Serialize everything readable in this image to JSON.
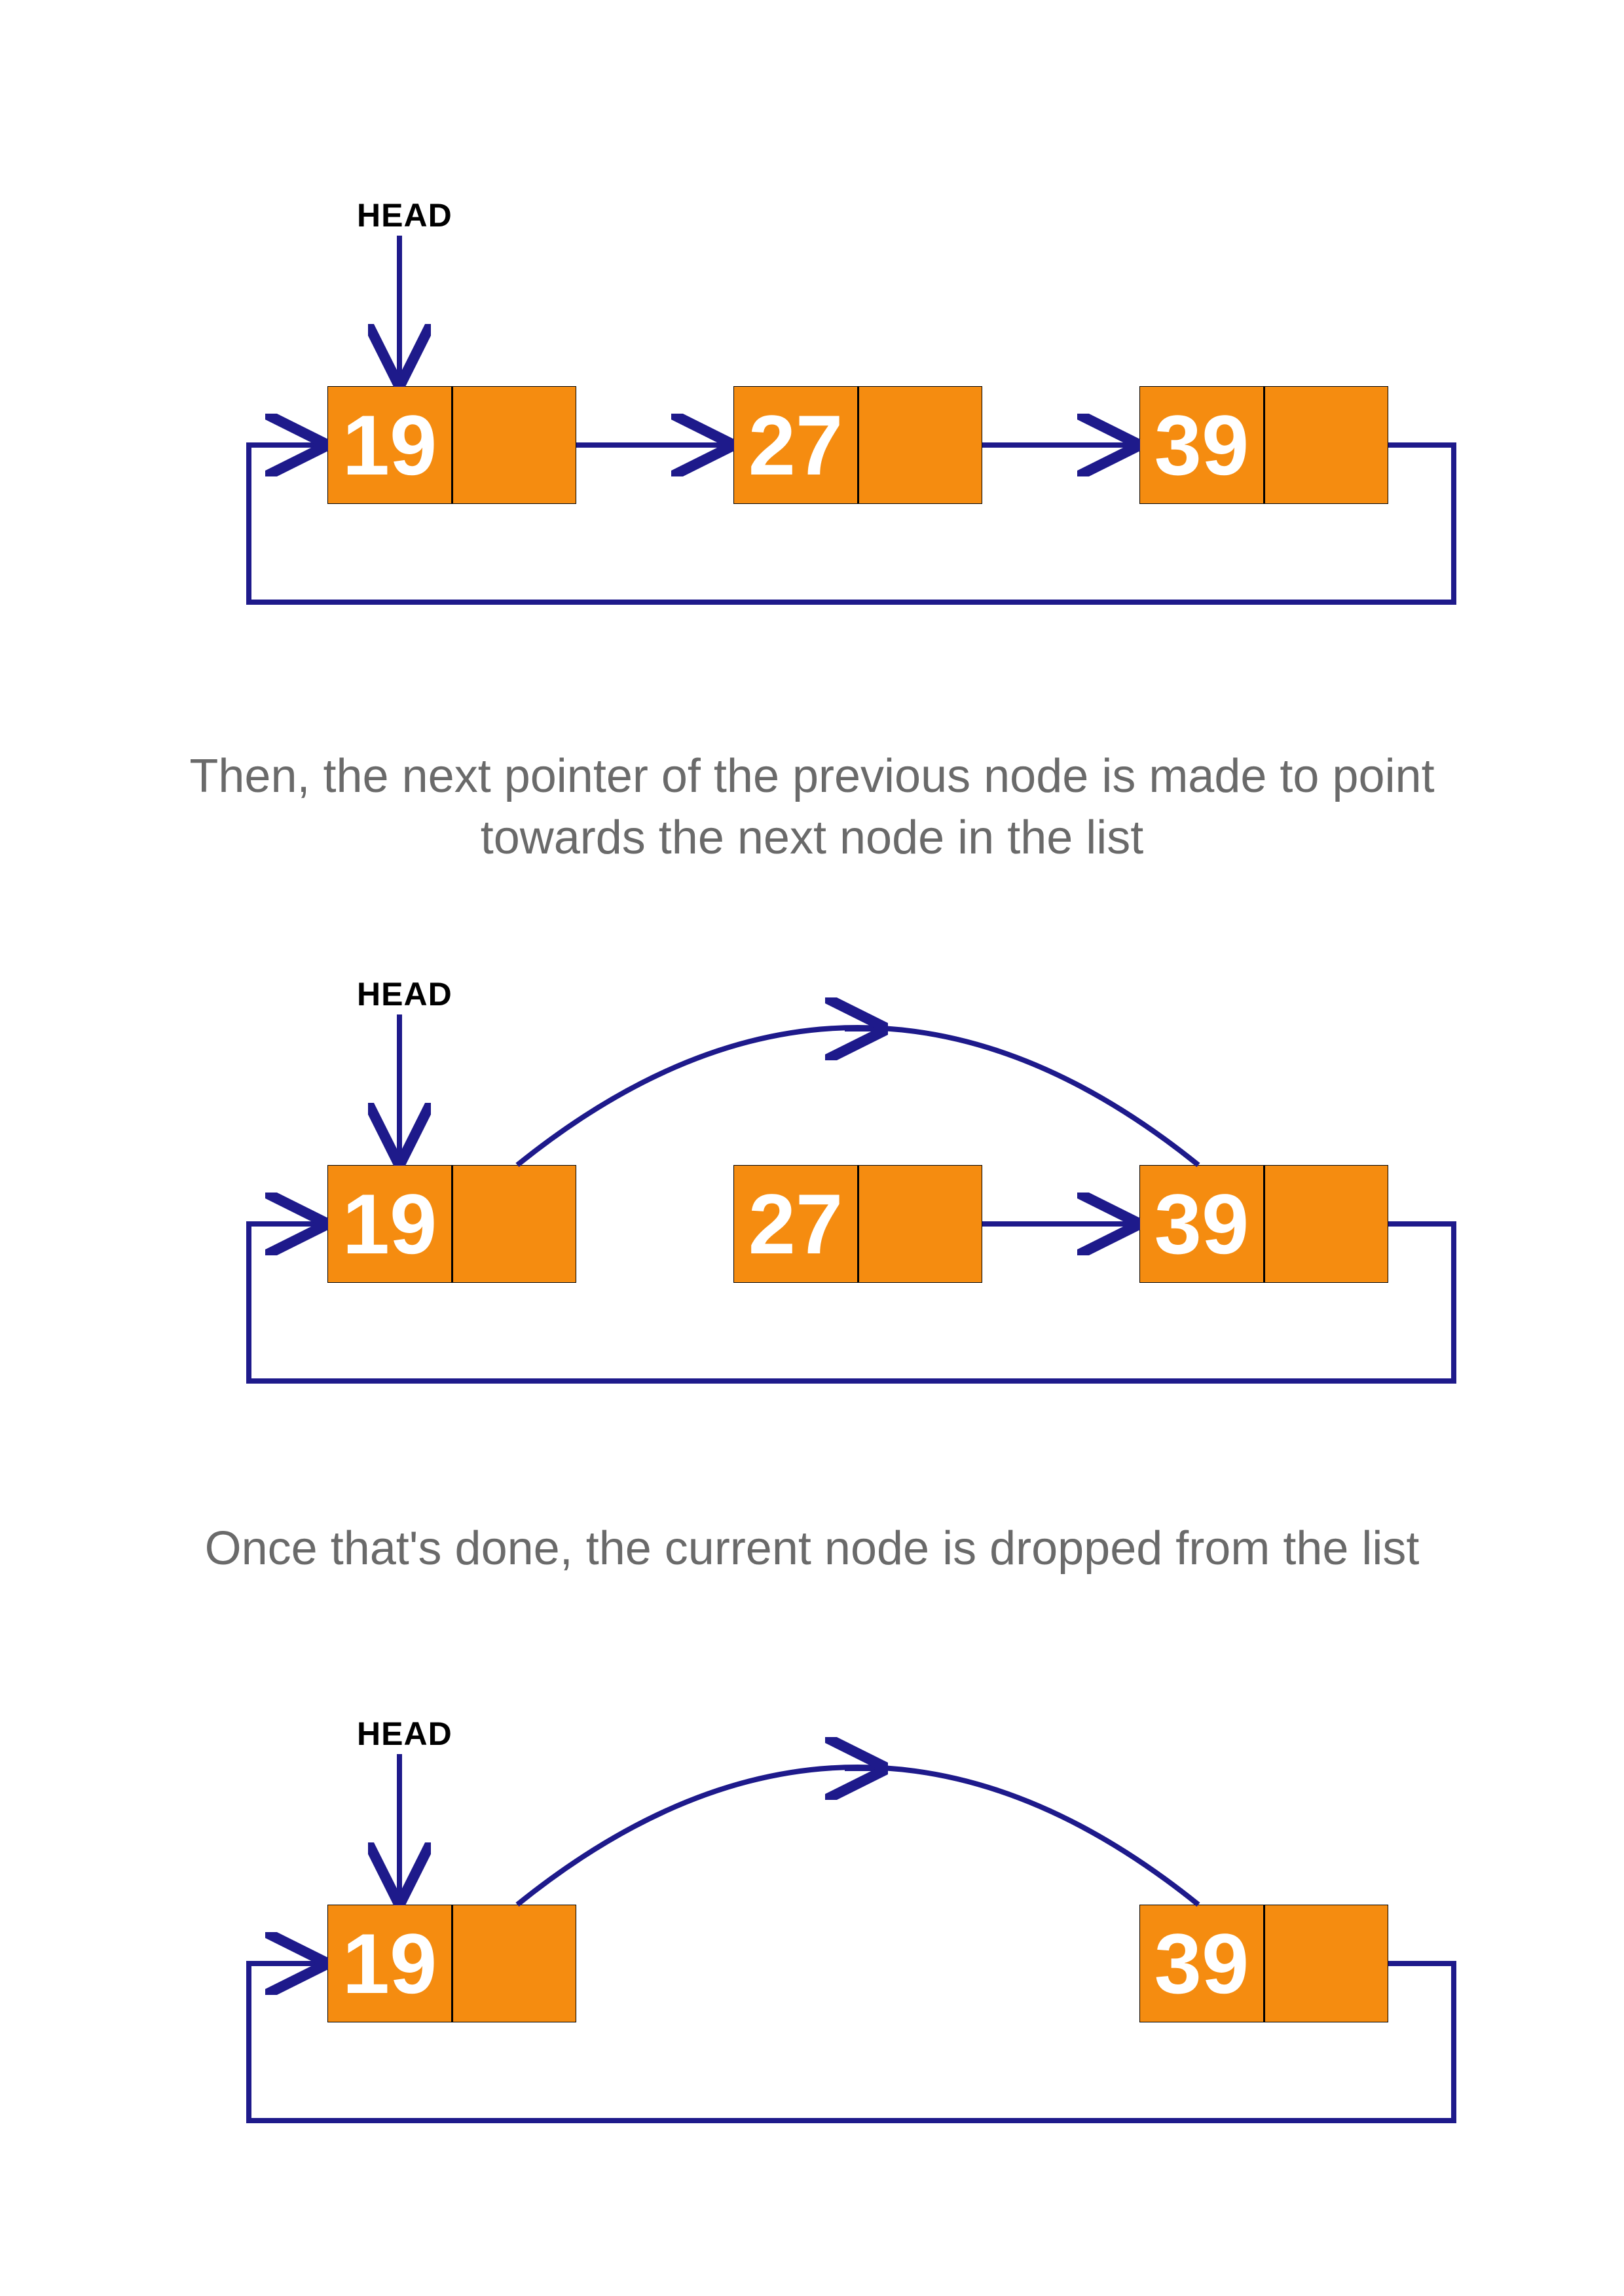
{
  "labels": {
    "head": "HEAD"
  },
  "captions": {
    "step2": "Then, the next pointer of the previous node is made to point towards the next node in the list",
    "step3": "Once that's done, the current node is dropped from the list"
  },
  "colors": {
    "node_fill": "#f58c10",
    "arrow": "#1e1a8b",
    "caption": "#6a6a6a"
  },
  "nodes": {
    "a": "19",
    "b": "27",
    "c": "39"
  },
  "diagrams": [
    {
      "head_points_to": "a",
      "visible_nodes": [
        "a",
        "b",
        "c"
      ],
      "pointers": [
        [
          "a",
          "b"
        ],
        [
          "b",
          "c"
        ],
        [
          "c",
          "a_loop"
        ]
      ]
    },
    {
      "head_points_to": "a",
      "visible_nodes": [
        "a",
        "b",
        "c"
      ],
      "pointers": [
        [
          "a",
          "c_arc"
        ],
        [
          "b",
          "c"
        ],
        [
          "c",
          "a_loop"
        ]
      ]
    },
    {
      "head_points_to": "a",
      "visible_nodes": [
        "a",
        "c"
      ],
      "pointers": [
        [
          "a",
          "c_arc"
        ],
        [
          "c",
          "a_loop"
        ]
      ]
    }
  ]
}
